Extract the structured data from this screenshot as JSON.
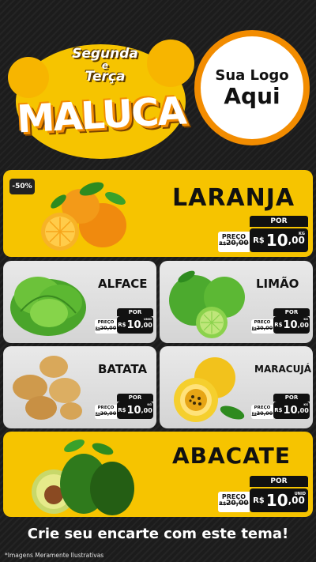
{
  "header": {
    "title_line1": "Segunda",
    "title_line2": "e",
    "title_line3": "Terça",
    "title_main": "MALUCA",
    "logo_line1": "Sua Logo",
    "logo_line2": "Aqui"
  },
  "products": {
    "laranja": {
      "name": "LARANJA",
      "discount": "-50%",
      "price_label": "PREÇO",
      "old_currency": "R$",
      "old_price": "20,00",
      "por": "POR",
      "currency": "R$",
      "price_int": "10",
      "price_cents": ",00",
      "unit": "KG"
    },
    "alface": {
      "name": "ALFACE",
      "price_label": "PREÇO",
      "old_currency": "R$",
      "old_price": "20,00",
      "por": "POR",
      "currency": "R$",
      "price_int": "10",
      "price_cents": ",00",
      "unit": "UNID"
    },
    "limao": {
      "name": "LIMÃO",
      "price_label": "PREÇO",
      "old_currency": "R$",
      "old_price": "20,00",
      "por": "POR",
      "currency": "R$",
      "price_int": "10",
      "price_cents": ",00",
      "unit": "KG"
    },
    "batata": {
      "name": "BATATA",
      "price_label": "PREÇO",
      "old_currency": "R$",
      "old_price": "20,00",
      "por": "POR",
      "currency": "R$",
      "price_int": "10",
      "price_cents": ",00",
      "unit": "KG"
    },
    "maracuja": {
      "name": "MARACUJÁ",
      "price_label": "PREÇO",
      "old_currency": "R$",
      "old_price": "20,00",
      "por": "POR",
      "currency": "R$",
      "price_int": "10",
      "price_cents": ",00",
      "unit": "KG"
    },
    "abacate": {
      "name": "ABACATE",
      "price_label": "PREÇO",
      "old_currency": "R$",
      "old_price": "20,00",
      "por": "POR",
      "currency": "R$",
      "price_int": "10",
      "price_cents": ",00",
      "unit": "UNID"
    }
  },
  "banner": {
    "text": "Crie seu encarte com este tema!"
  },
  "footer": {
    "disclaimer": "*Imagens Meramente Ilustrativas"
  },
  "colors": {
    "accent_yellow": "#f6c400",
    "accent_orange": "#f28c00",
    "background": "#1c1c1c"
  }
}
